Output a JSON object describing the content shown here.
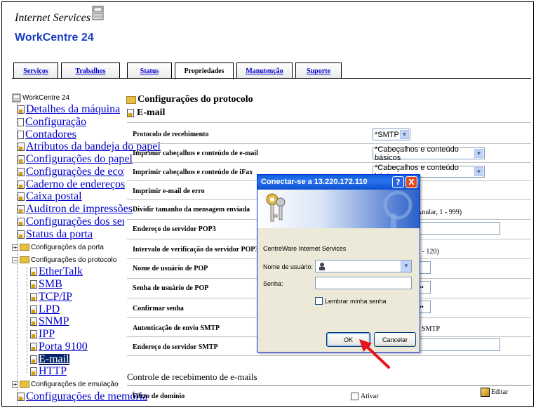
{
  "header": {
    "product_title": "Internet Services",
    "device_name": "WorkCentre 24"
  },
  "tabs": [
    {
      "label": "Serviços"
    },
    {
      "label": "Trabalhos"
    },
    {
      "label": "Status"
    },
    {
      "label": "Propriedades",
      "active": true
    },
    {
      "label": "Manutenção"
    },
    {
      "label": "Suporte"
    }
  ],
  "tree": {
    "root": "WorkCentre 24",
    "items": [
      "Detalhes da máquina",
      "Configuração",
      "Contadores",
      "Atributos da bandeja do papel",
      "Configurações do papel",
      "Configurações de economia de ene",
      "Caderno de endereços",
      "Caixa postal",
      "Auditron de impressões",
      "Configurações dos serviços da Int",
      "Status da porta"
    ],
    "port_settings": "Configurações da porta",
    "protocol_settings": "Configurações do protocolo",
    "protocol_items": [
      "EtherTalk",
      "SMB",
      "TCP/IP",
      "LPD",
      "SNMP",
      "IPP",
      "Porta 9100",
      "E-mail",
      "HTTP"
    ],
    "selected": "E-mail",
    "emulation_settings": "Configurações de emulação",
    "memory_settings": "Configurações de memória"
  },
  "main": {
    "section_title": "Configurações do protocolo",
    "page_title": "E-mail",
    "rows": {
      "receive_protocol": "Protocolo de recebimento",
      "print_headers_email": "Imprimir cabeçalhos e conteúdo de e-mail",
      "print_headers_ifax": "Imprimir cabeçalhos e conteúdo de iFax",
      "print_error_email": "Imprimir e-mail de erro",
      "split_size": "Dividir tamanho da mensagem enviada",
      "pop3_address": "Endereço do servidor POP3",
      "pop3_interval": "Intervalo de verificação do servidor POP3",
      "pop_user": "Nome de usuário de POP",
      "pop_password": "Senha de usuário de POP",
      "confirm_password": "Confirmar senha",
      "smtp_auth": "Autenticação de envio SMTP",
      "smtp_address": "Endereço do servidor SMTP"
    },
    "values": {
      "receive_protocol": "*SMTP",
      "print_headers_email": "*Cabeçalhos e conteúdo básicos",
      "print_headers_ifax": "*Cabeçalhos e conteúdo básicos",
      "split_hint": "Anular, 1 - 999)",
      "interval_hint": "1 - 120)",
      "password_mask": "••••",
      "confirm_mask": "••••",
      "smtp_auth_value": "SMTP"
    },
    "receive_control_title": "Controle de recebimento de e-mails",
    "domain_filter": "Filtro de domínio",
    "enable_label": "Ativar",
    "edit_label": "Editar"
  },
  "dialog": {
    "title": "Conectar-se a 13.220.172.110",
    "site": "CentreWare Internet Services",
    "username_label": "Nome de usuário:",
    "password_label": "Senha:",
    "remember_label": "Lembrar minha senha",
    "ok_label": "OK",
    "cancel_label": "Cancelar",
    "help_glyph": "?",
    "close_glyph": "X"
  },
  "colors": {
    "link": "#0000cc",
    "device_name": "#1a3fc0",
    "dialog_title": "#0a5ddc",
    "arrow": "#e8141c"
  }
}
